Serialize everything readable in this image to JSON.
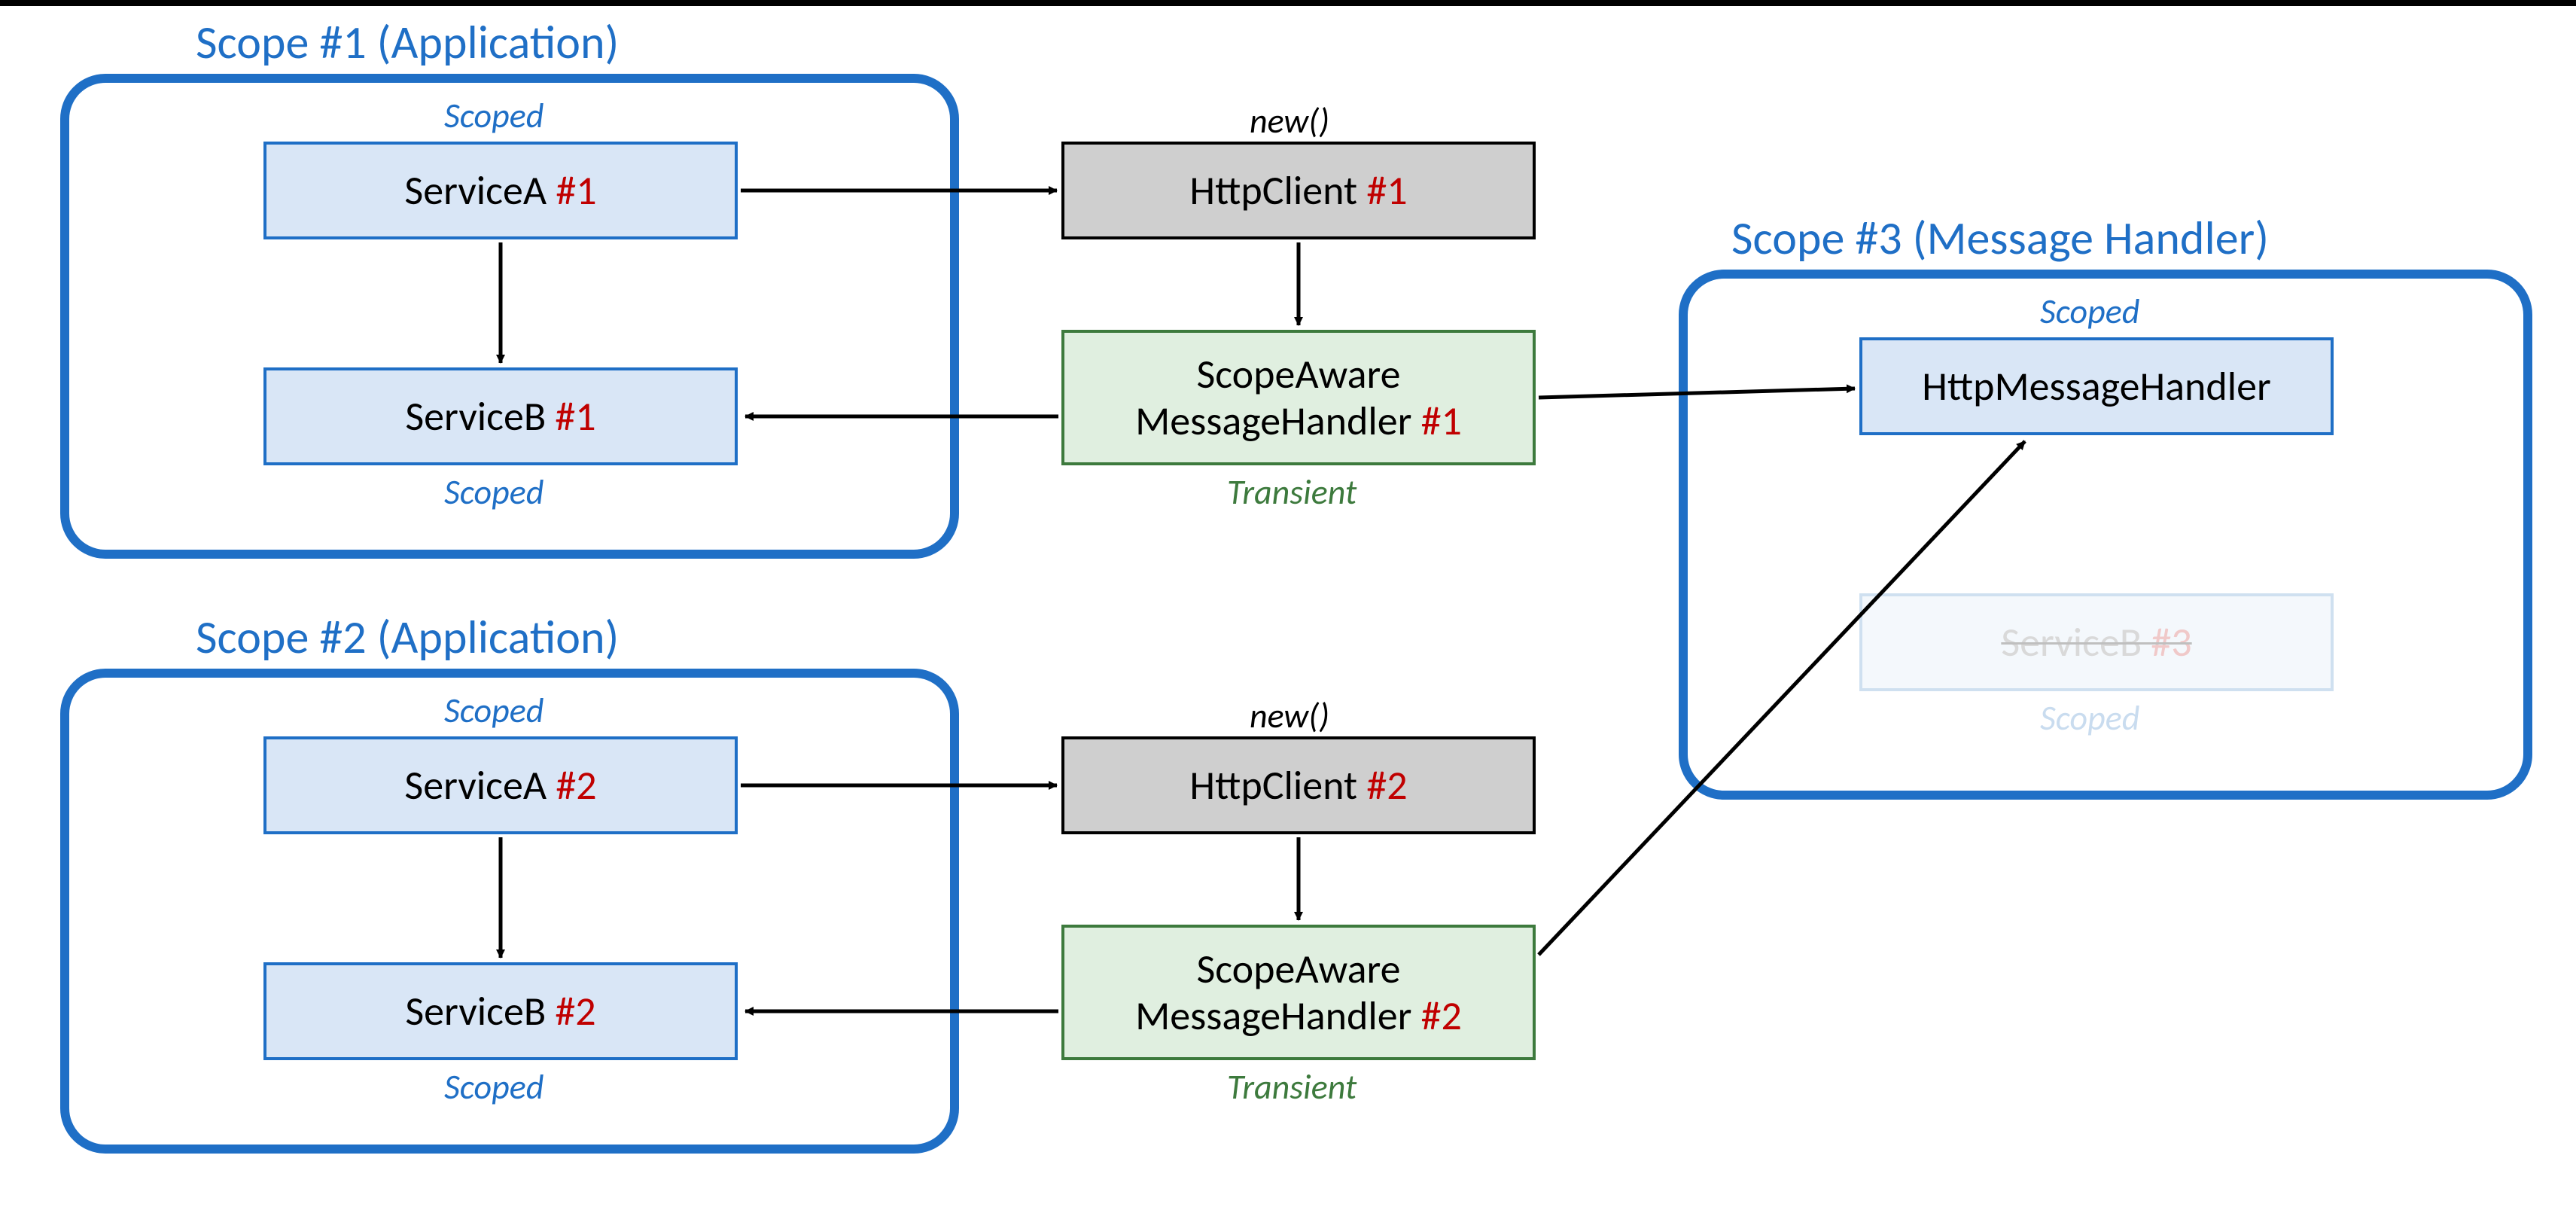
{
  "scopes": {
    "s1": {
      "title": "Scope #1 (Application)"
    },
    "s2": {
      "title": "Scope #2 (Application)"
    },
    "s3": {
      "title": "Scope #3 (Message Handler)"
    }
  },
  "boxes": {
    "serviceA1": {
      "name": "ServiceA ",
      "num": "#1",
      "lifetime": "Scoped"
    },
    "serviceB1": {
      "name": "ServiceB ",
      "num": "#1",
      "lifetime": "Scoped"
    },
    "serviceA2": {
      "name": "ServiceA ",
      "num": "#2",
      "lifetime": "Scoped"
    },
    "serviceB2": {
      "name": "ServiceB ",
      "num": "#2",
      "lifetime": "Scoped"
    },
    "httpClient1": {
      "name": "HttpClient ",
      "num": "#1",
      "anno": "new()"
    },
    "httpClient2": {
      "name": "HttpClient ",
      "num": "#2",
      "anno": "new()"
    },
    "scopeAware1": {
      "line1": "ScopeAware",
      "line2a": "MessageHandler ",
      "num": "#1",
      "lifetime": "Transient"
    },
    "scopeAware2": {
      "line1": "ScopeAware",
      "line2a": "MessageHandler ",
      "num": "#2",
      "lifetime": "Transient"
    },
    "httpMsgHandler": {
      "name": "HttpMessageHandler",
      "lifetime": "Scoped"
    },
    "serviceB3": {
      "name": "ServiceB ",
      "num": "#3",
      "lifetime": "Scoped"
    }
  }
}
